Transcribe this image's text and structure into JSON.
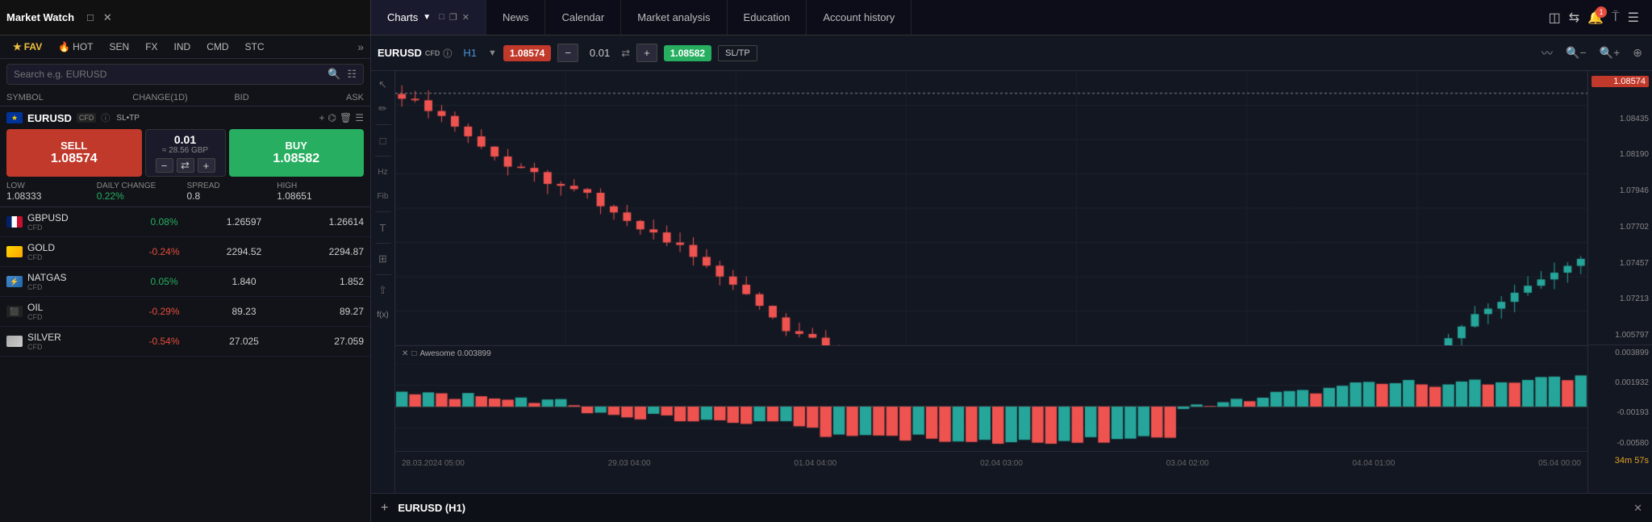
{
  "app": {
    "title": "Market Watch"
  },
  "topnav": {
    "charts_label": "Charts",
    "news_label": "News",
    "calendar_label": "Calendar",
    "market_analysis_label": "Market analysis",
    "education_label": "Education",
    "account_history_label": "Account history"
  },
  "marketwatch": {
    "tabs": [
      {
        "id": "fav",
        "label": "FAV",
        "active": true
      },
      {
        "id": "hot",
        "label": "HOT",
        "active": false
      },
      {
        "id": "sen",
        "label": "SEN",
        "active": false
      },
      {
        "id": "fx",
        "label": "FX",
        "active": false
      },
      {
        "id": "ind",
        "label": "IND",
        "active": false
      },
      {
        "id": "cmd",
        "label": "CMD",
        "active": false
      },
      {
        "id": "stc",
        "label": "STC",
        "active": false
      }
    ],
    "search_placeholder": "Search e.g. EURUSD",
    "columns": {
      "symbol": "SYMBOL",
      "change": "CHANGE(1D)",
      "bid": "BID",
      "ask": "ASK"
    },
    "featured": {
      "symbol": "EURUSD",
      "cfd": "CFD",
      "sell_label": "SELL",
      "sell_price": "1.08574",
      "buy_label": "BUY",
      "buy_price": "1.08582",
      "amount": "0.01",
      "amount_approx": "≈ 28.56 GBP",
      "low_label": "LOW",
      "low_value": "1.08333",
      "daily_change_label": "DAILY CHANGE",
      "daily_change_value": "0.22%",
      "spread_label": "SPREAD",
      "spread_value": "0.8",
      "high_label": "HIGH",
      "high_value": "1.08651"
    },
    "symbols": [
      {
        "name": "GBPUSD",
        "cfd": "CFD",
        "change": "0.08%",
        "change_dir": "positive",
        "bid": "1.26597",
        "ask": "1.26614",
        "flag": "gb"
      },
      {
        "name": "GOLD",
        "cfd": "CFD",
        "change": "-0.24%",
        "change_dir": "negative",
        "bid": "2294.52",
        "ask": "2294.87",
        "flag": "gold"
      },
      {
        "name": "NATGAS",
        "cfd": "CFD",
        "change": "0.05%",
        "change_dir": "positive",
        "bid": "1.840",
        "ask": "1.852",
        "flag": "ng"
      },
      {
        "name": "OIL",
        "cfd": "CFD",
        "change": "-0.29%",
        "change_dir": "negative",
        "bid": "89.23",
        "ask": "89.27",
        "flag": "oil"
      },
      {
        "name": "SILVER",
        "cfd": "CFD",
        "change": "-0.54%",
        "change_dir": "negative",
        "bid": "27.025",
        "ask": "27.059",
        "flag": "ag"
      }
    ]
  },
  "chart": {
    "symbol": "EURUSD",
    "cfd": "CFD",
    "timeframe": "H1",
    "sell_price": "1.08574",
    "lot": "0.01",
    "buy_price": "1.08582",
    "sltp_label": "SL/TP",
    "current_price": "1.08574",
    "timer": "34m 57s",
    "price_levels": [
      "1.08574",
      "1.08435",
      "1.08190",
      "1.07946",
      "1.07702",
      "1.07457",
      "1.07213",
      "1.005797"
    ],
    "indicator_price_levels": [
      "0.003899",
      "0.001932",
      "-0.00193",
      "-0.00580"
    ],
    "indicator_label": "✕ □ Awesome 0.003899",
    "time_labels": [
      "28.03.2024 05:00",
      "29.03 04:00",
      "01.04 04:00",
      "02.04 03:00",
      "03.04 02:00",
      "04.04 01:00",
      "05.04 00:00"
    ],
    "bottom_symbol": "EURUSD (H1)"
  },
  "colors": {
    "bull": "#26a69a",
    "bear": "#ef5350",
    "background": "#131722",
    "grid": "#1e222d",
    "indicator_bull": "#26a69a",
    "indicator_bear": "#ef5350"
  }
}
